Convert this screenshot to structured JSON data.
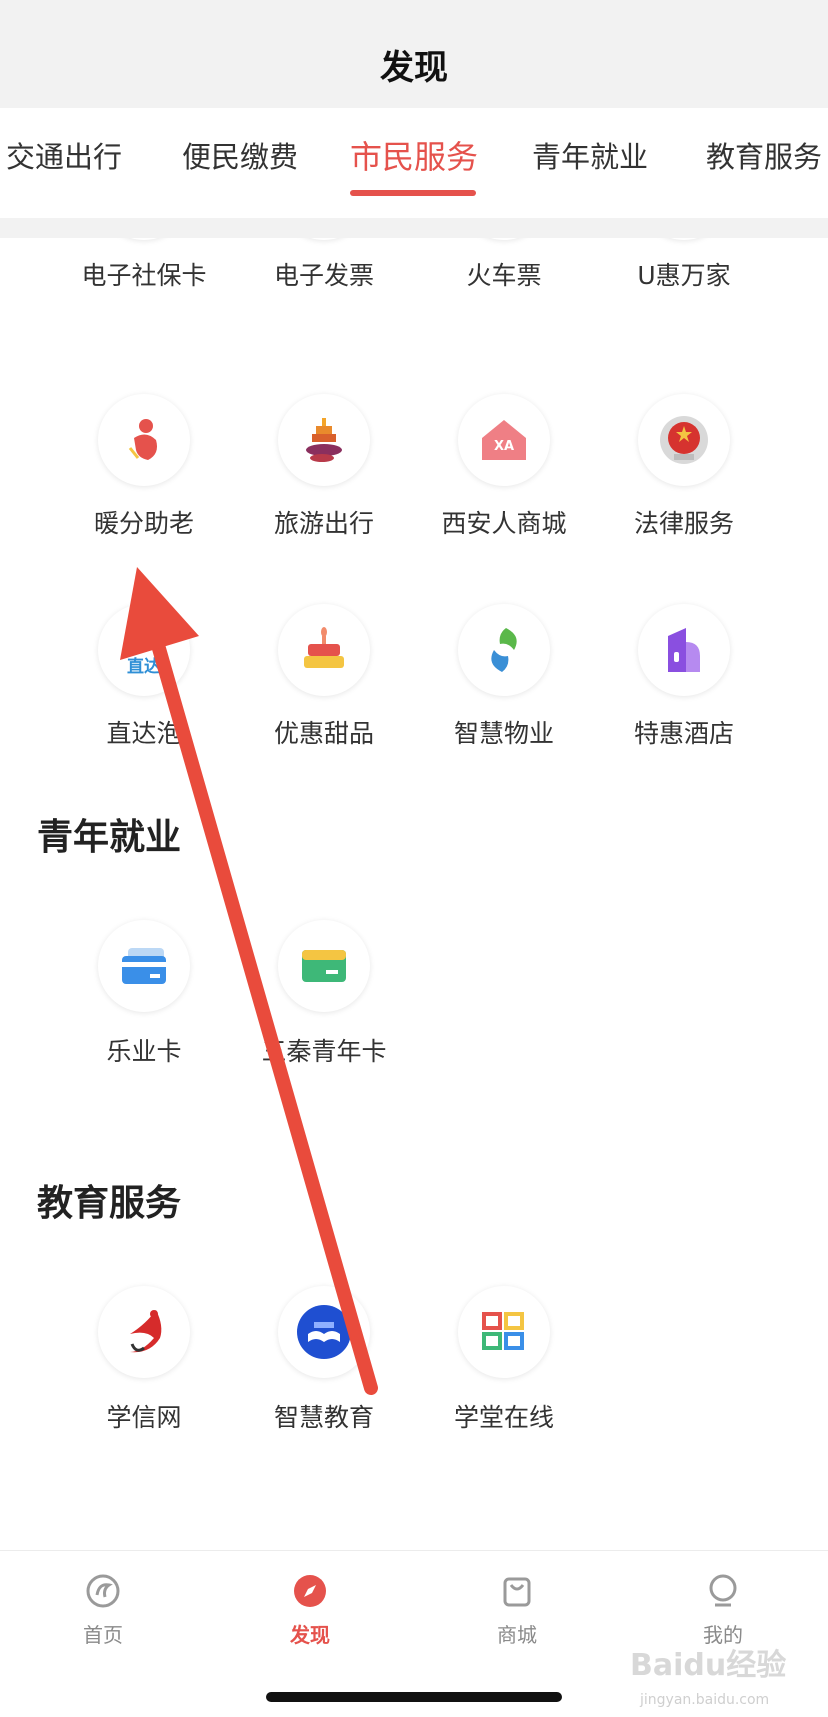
{
  "header": {
    "title": "发现"
  },
  "tabs": [
    {
      "label": "交通出行"
    },
    {
      "label": "便民缴费"
    },
    {
      "label": "市民服务"
    },
    {
      "label": "青年就业"
    },
    {
      "label": "教育服务"
    }
  ],
  "active_tab": "市民服务",
  "civic": {
    "items": [
      {
        "label": "电子社保卡",
        "icon": "social-security-card-icon"
      },
      {
        "label": "电子发票",
        "icon": "e-invoice-icon"
      },
      {
        "label": "火车票",
        "icon": "train-ticket-icon"
      },
      {
        "label": "U惠万家",
        "icon": "u-hui-icon"
      },
      {
        "label": "暖分助老",
        "icon": "elder-care-icon"
      },
      {
        "label": "旅游出行",
        "icon": "travel-icon"
      },
      {
        "label": "西安人商城",
        "icon": "xa-mall-icon"
      },
      {
        "label": "法律服务",
        "icon": "national-emblem-icon"
      },
      {
        "label": "直达泡",
        "icon": "zhida-icon"
      },
      {
        "label": "优惠甜品",
        "icon": "cake-icon"
      },
      {
        "label": "智慧物业",
        "icon": "smart-property-icon"
      },
      {
        "label": "特惠酒店",
        "icon": "hotel-icon"
      }
    ],
    "zhida_icon_text": "直达",
    "xa_icon_text": "XA"
  },
  "youth": {
    "title": "青年就业",
    "items": [
      {
        "label": "乐业卡",
        "icon": "blue-card-icon"
      },
      {
        "label": "三秦青年卡",
        "icon": "green-card-icon"
      }
    ]
  },
  "education": {
    "title": "教育服务",
    "items": [
      {
        "label": "学信网",
        "icon": "xuexin-icon"
      },
      {
        "label": "智慧教育",
        "icon": "smart-education-icon"
      },
      {
        "label": "学堂在线",
        "icon": "xuetang-icon"
      }
    ]
  },
  "tabbar": [
    {
      "label": "首页",
      "icon": "home-icon"
    },
    {
      "label": "发现",
      "icon": "compass-icon"
    },
    {
      "label": "商城",
      "icon": "shopping-bag-icon"
    },
    {
      "label": "我的",
      "icon": "profile-icon"
    }
  ],
  "active_tabbar": "发现",
  "watermark": {
    "text": "Baidu经验",
    "sub": "jingyan.baidu.com"
  },
  "colors": {
    "accent": "#e5524c",
    "header_bg": "#f2f2f2",
    "arrow": "#e94b3c"
  }
}
